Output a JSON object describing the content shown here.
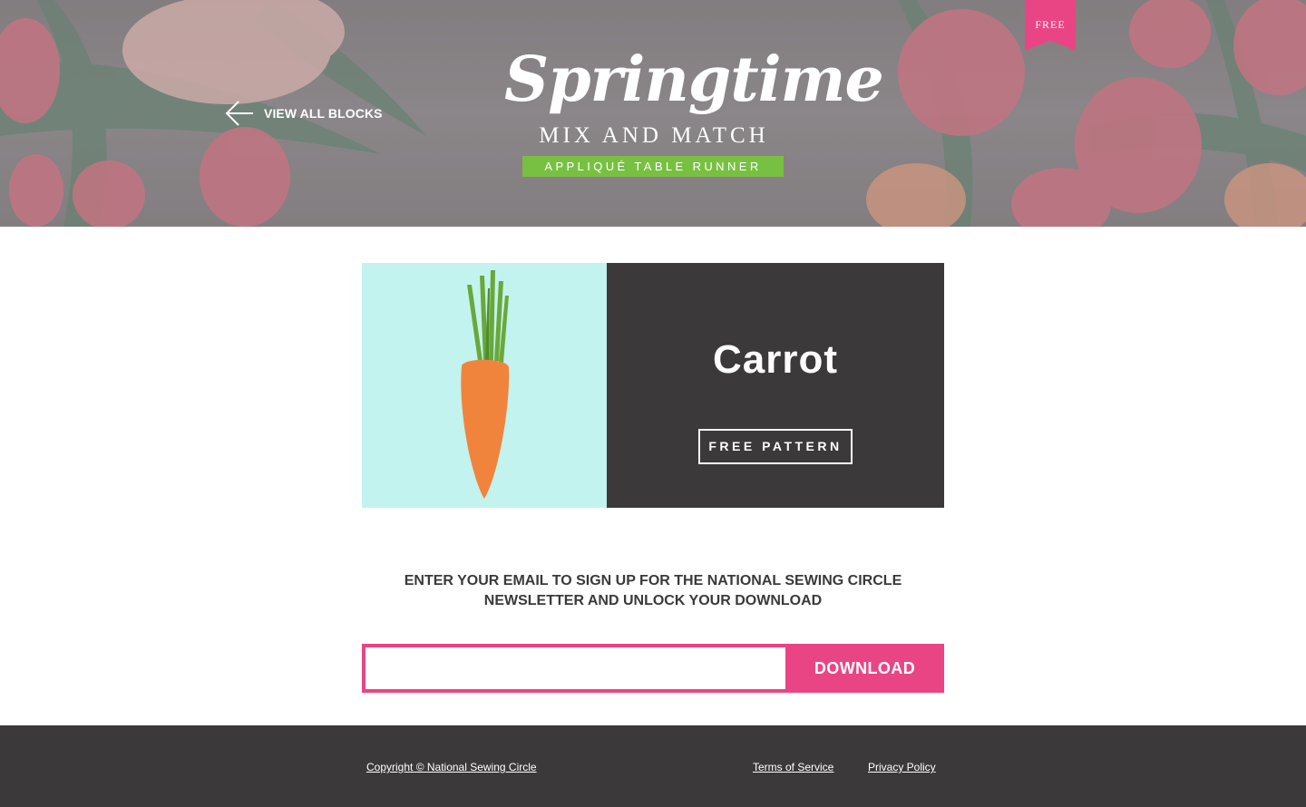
{
  "hero": {
    "back_label": "VIEW ALL BLOCKS",
    "logo_script": "Springtime",
    "logo_subtitle": "MIX AND MATCH",
    "logo_band": "APPLIQUÉ TABLE RUNNER",
    "ribbon_label": "FREE",
    "colors": {
      "ribbon": "#e94585",
      "band": "#78c042"
    }
  },
  "card": {
    "title": "Carrot",
    "button_label": "FREE PATTERN",
    "colors": {
      "art_bg": "#c2f3ee",
      "info_bg": "#3c393b",
      "carrot": "#f1843d",
      "leaves": "#6aa83a"
    }
  },
  "signup": {
    "text": "ENTER YOUR EMAIL TO SIGN UP FOR THE NATIONAL SEWING CIRCLE NEWSLETTER AND UNLOCK YOUR DOWNLOAD",
    "email_value": "",
    "email_placeholder": "",
    "button_label": "DOWNLOAD",
    "colors": {
      "accent": "#e94585"
    }
  },
  "footer": {
    "copyright": "Copyright © National Sewing Circle",
    "terms": "Terms of Service",
    "privacy": "Privacy Policy"
  }
}
